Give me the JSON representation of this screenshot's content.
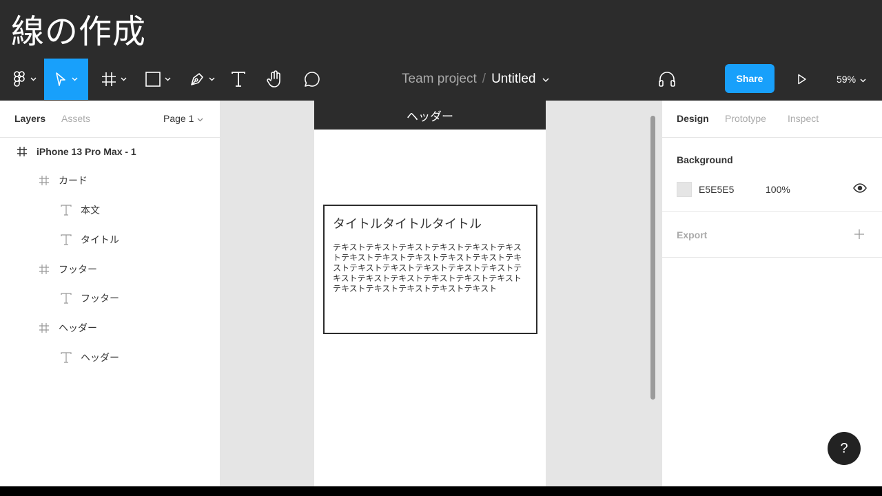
{
  "slide": {
    "title": "線の作成"
  },
  "toolbar": {
    "tools": [
      {
        "name": "figma-menu",
        "icon": "figma-logo-icon"
      },
      {
        "name": "move",
        "icon": "move-arrow-icon",
        "active": true
      },
      {
        "name": "frame",
        "icon": "frame-hash-icon"
      },
      {
        "name": "shape",
        "icon": "rectangle-icon"
      },
      {
        "name": "pen",
        "icon": "pen-icon"
      },
      {
        "name": "text",
        "icon": "text-t-icon"
      },
      {
        "name": "hand",
        "icon": "hand-icon"
      },
      {
        "name": "comment",
        "icon": "comment-bubble-icon"
      }
    ],
    "breadcrumb": {
      "team": "Team project",
      "separator": "/",
      "file": "Untitled"
    },
    "share_label": "Share",
    "zoom": "59%",
    "accent": "#18a0fb"
  },
  "left_panel": {
    "tabs": {
      "layers": "Layers",
      "assets": "Assets"
    },
    "page": "Page 1",
    "layers": [
      {
        "label": "iPhone 13 Pro Max - 1",
        "type": "frame",
        "depth": 0
      },
      {
        "label": "カード",
        "type": "frame",
        "depth": 1
      },
      {
        "label": "本文",
        "type": "text",
        "depth": 2
      },
      {
        "label": "タイトル",
        "type": "text",
        "depth": 2
      },
      {
        "label": "フッター",
        "type": "frame",
        "depth": 1
      },
      {
        "label": "フッター",
        "type": "text",
        "depth": 2
      },
      {
        "label": "ヘッダー",
        "type": "frame",
        "depth": 1
      },
      {
        "label": "ヘッダー",
        "type": "text",
        "depth": 2
      }
    ]
  },
  "canvas": {
    "header_text": "ヘッダー",
    "card": {
      "title": "タイトルタイトルタイトル",
      "body": "テキストテキストテキストテキストテキストテキストテキストテキストテキストテキストテキストテキストテキストテキストテキストテキストテキストテキストテキストテキストテキストテキストテキストテキストテキストテキストテキストテキスト"
    },
    "background": "#e5e5e5"
  },
  "right_panel": {
    "tabs": {
      "design": "Design",
      "prototype": "Prototype",
      "inspect": "Inspect"
    },
    "background": {
      "heading": "Background",
      "hex": "E5E5E5",
      "opacity": "100%"
    },
    "export": {
      "heading": "Export"
    },
    "help": "?"
  }
}
